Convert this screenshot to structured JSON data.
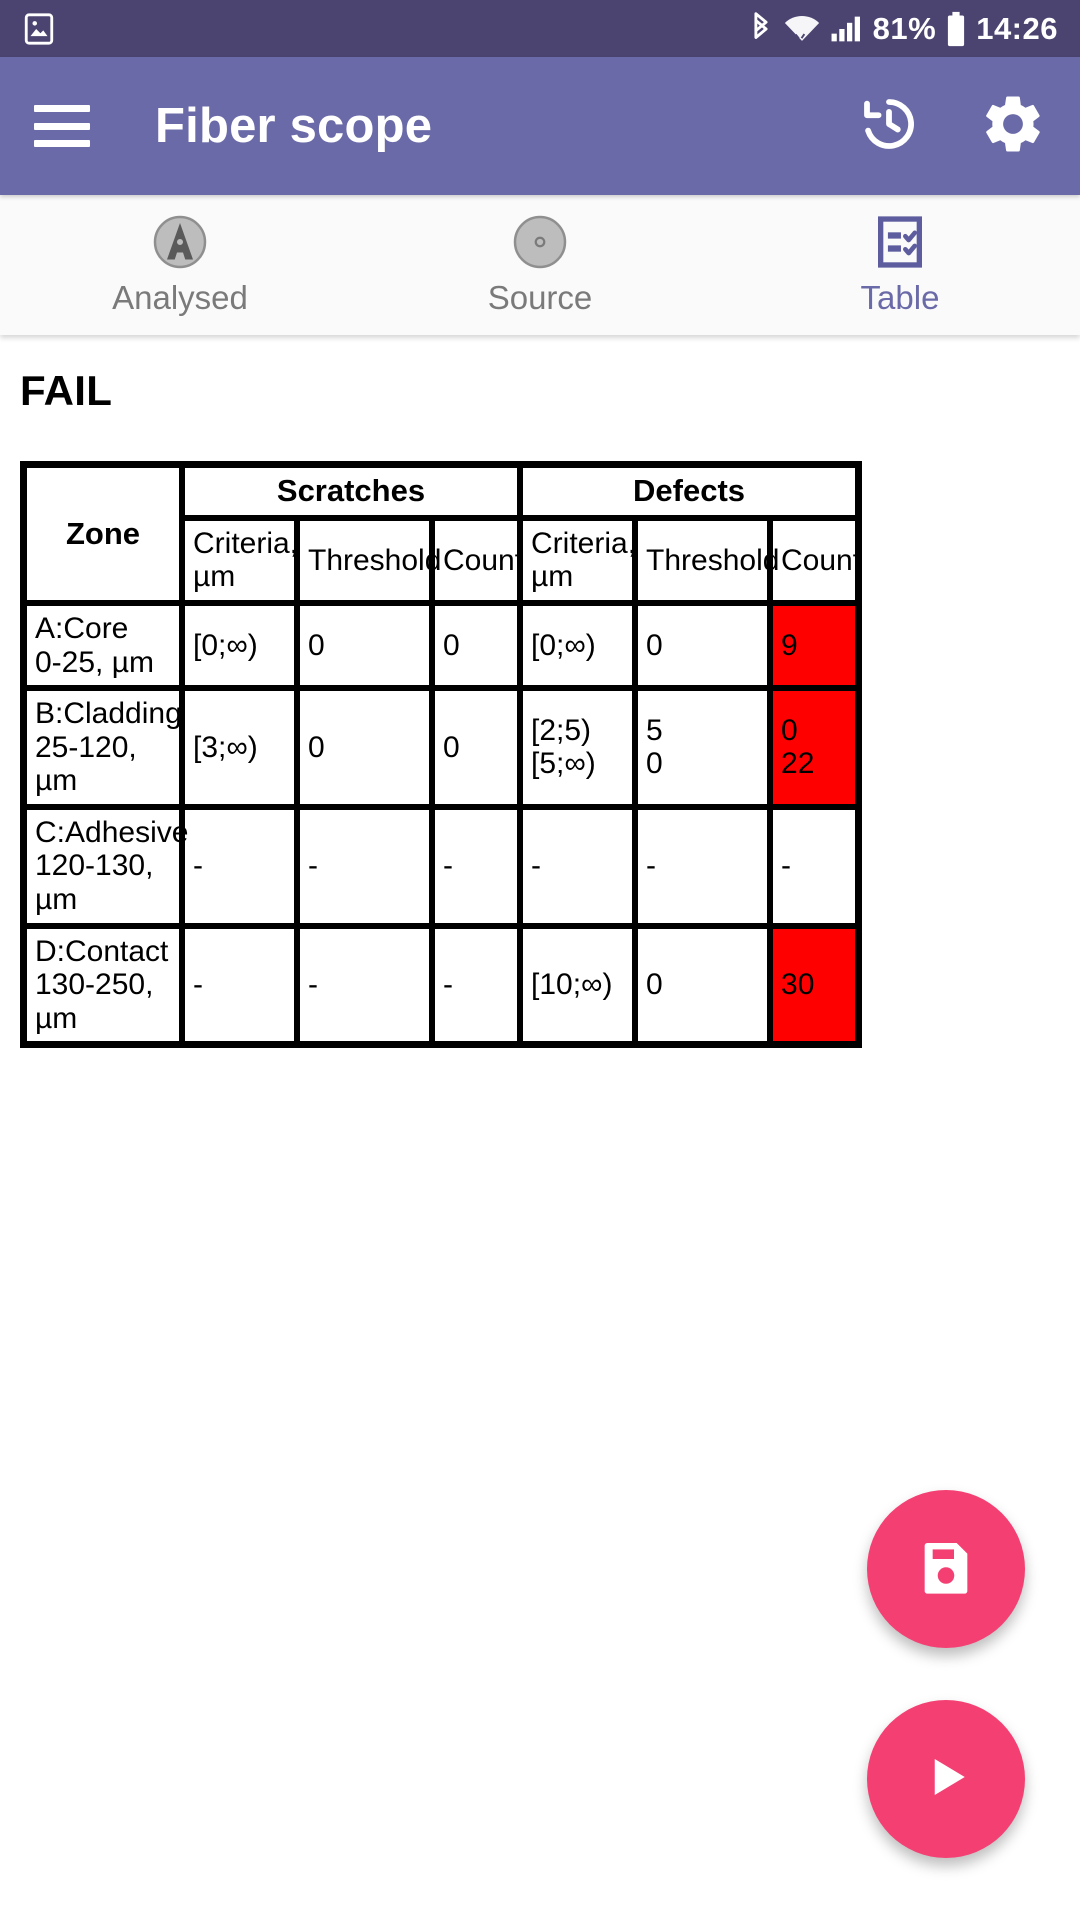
{
  "statusbar": {
    "left_icon": "photo-icon",
    "icons": [
      "bluetooth-icon",
      "wifi-icon",
      "cell-signal-icon"
    ],
    "battery_percent": "81%",
    "battery_icon": "battery-icon",
    "time": "14:26"
  },
  "appbar": {
    "menu_icon": "hamburger-menu-icon",
    "title": "Fiber scope",
    "history_icon": "history-icon",
    "settings_icon": "gear-icon",
    "background": "#6a6aa8"
  },
  "tabs": [
    {
      "label": "Analysed",
      "icon": "analysed-fiber-icon",
      "active": false
    },
    {
      "label": "Source",
      "icon": "source-fiber-icon",
      "active": false
    },
    {
      "label": "Table",
      "icon": "table-checklist-icon",
      "active": true
    }
  ],
  "verdict": "FAIL",
  "accent_color": "#6a6aa8",
  "fail_color": "#fe0000",
  "fab_color": "#f43f72",
  "table": {
    "group_headers": [
      "Scratches",
      "Defects"
    ],
    "zone_header": "Zone",
    "sub_headers": [
      "Criteria, µm",
      "Threshold",
      "Count",
      "Criteria, µm",
      "Threshold",
      "Count"
    ],
    "rows": [
      {
        "zone": [
          "A:Core",
          "0-25, µm"
        ],
        "scratch_criteria": [
          "[0;∞)"
        ],
        "scratch_threshold": [
          "0"
        ],
        "scratch_count": [
          "0"
        ],
        "defect_criteria": [
          "[0;∞)"
        ],
        "defect_threshold": [
          "0"
        ],
        "defect_count": [
          "9"
        ],
        "defect_count_fail": true,
        "scratch_count_fail": false
      },
      {
        "zone": [
          "B:Cladding",
          "25-120,",
          "µm"
        ],
        "scratch_criteria": [
          "[3;∞)"
        ],
        "scratch_threshold": [
          "0"
        ],
        "scratch_count": [
          "0"
        ],
        "defect_criteria": [
          "[2;5)",
          "[5;∞)"
        ],
        "defect_threshold": [
          "5",
          "0"
        ],
        "defect_count": [
          "0",
          "22"
        ],
        "defect_count_fail": true,
        "scratch_count_fail": false
      },
      {
        "zone": [
          "C:Adhesive",
          "120-130,",
          "µm"
        ],
        "scratch_criteria": [
          "-"
        ],
        "scratch_threshold": [
          "-"
        ],
        "scratch_count": [
          "-"
        ],
        "defect_criteria": [
          "-"
        ],
        "defect_threshold": [
          "-"
        ],
        "defect_count": [
          "-"
        ],
        "defect_count_fail": false,
        "scratch_count_fail": false
      },
      {
        "zone": [
          "D:Contact",
          "130-250,",
          "µm"
        ],
        "scratch_criteria": [
          "-"
        ],
        "scratch_threshold": [
          "-"
        ],
        "scratch_count": [
          "-"
        ],
        "defect_criteria": [
          "[10;∞)"
        ],
        "defect_threshold": [
          "0"
        ],
        "defect_count": [
          "30"
        ],
        "defect_count_fail": true,
        "scratch_count_fail": false
      }
    ]
  },
  "fabs": [
    {
      "name": "save",
      "icon": "floppy-save-icon"
    },
    {
      "name": "run",
      "icon": "play-icon"
    }
  ]
}
